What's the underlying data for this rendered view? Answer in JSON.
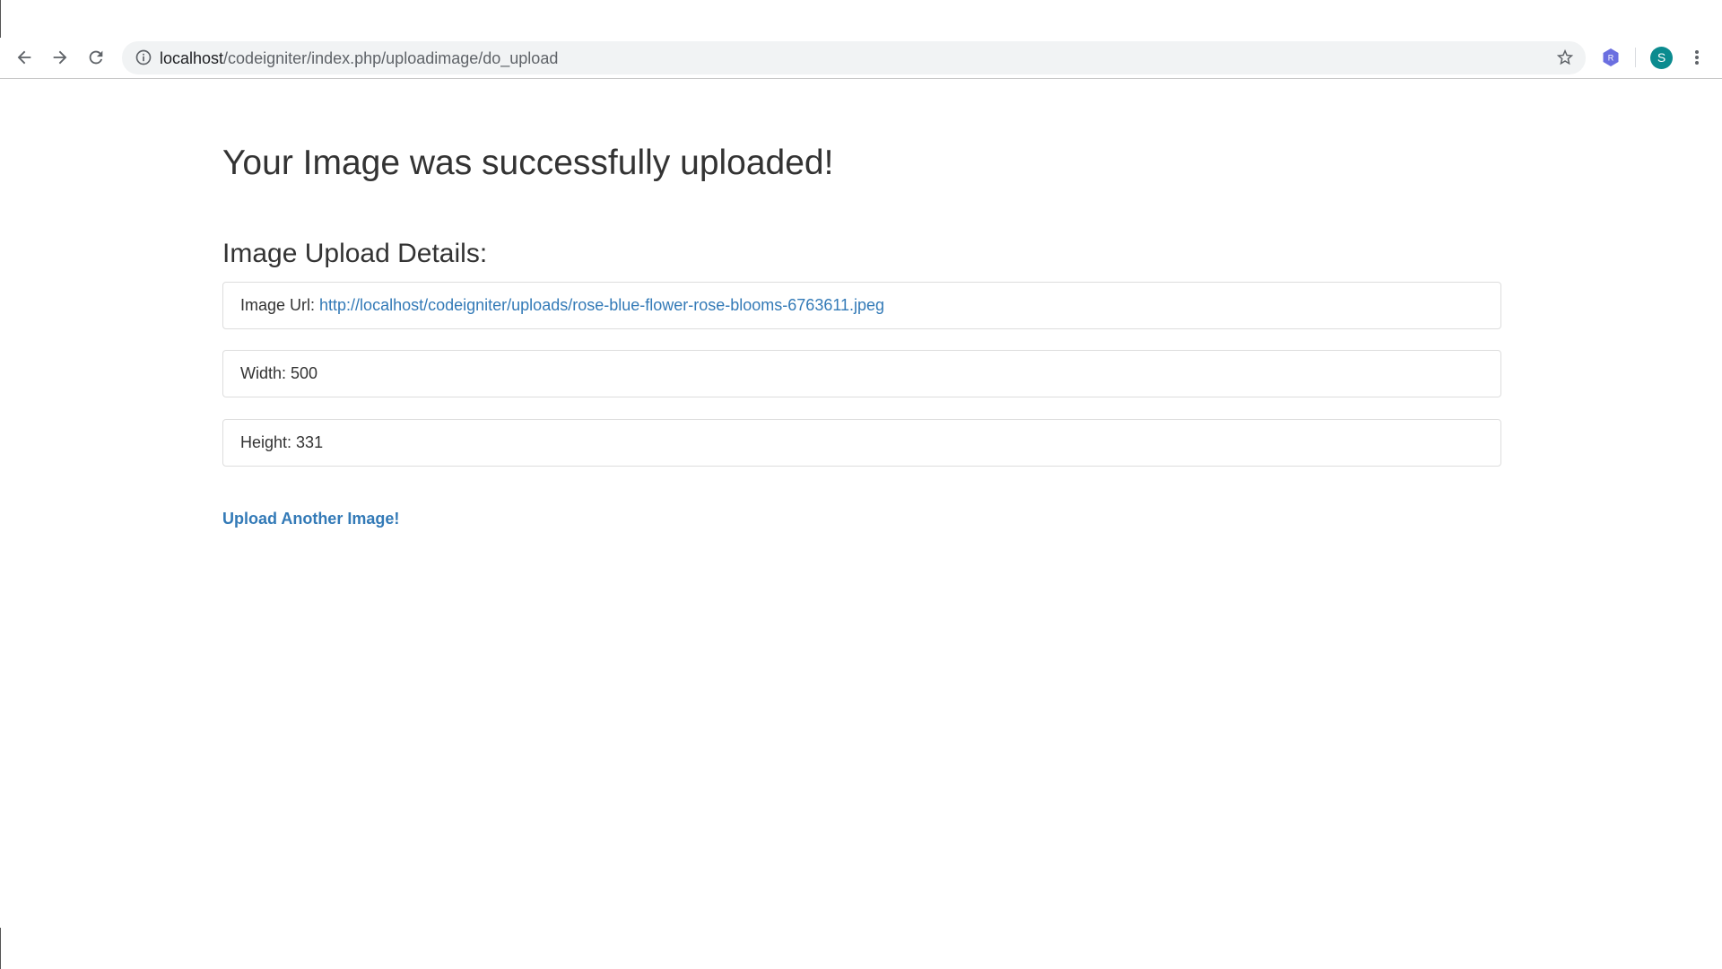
{
  "browser": {
    "url_host": "localhost",
    "url_path": "/codeigniter/index.php/uploadimage/do_upload",
    "avatar_letter": "S",
    "extension_letter": "R",
    "colors": {
      "address_bar_bg": "#f1f3f4",
      "avatar_bg": "#0b8b8f",
      "extension_bg": "#6b6fe0"
    }
  },
  "page": {
    "title": "Your Image was successfully uploaded!",
    "details_heading": "Image Upload Details:",
    "details": {
      "url_label": "Image Url:",
      "url_value": "http://localhost/codeigniter/uploads/rose-blue-flower-rose-blooms-6763611.jpeg",
      "width_label": "Width:",
      "width_value": "500",
      "height_label": "Height:",
      "height_value": "331"
    },
    "upload_another_label": "Upload Another Image!",
    "colors": {
      "link": "#337ab7",
      "text": "#333333",
      "border": "#dddddd"
    }
  }
}
